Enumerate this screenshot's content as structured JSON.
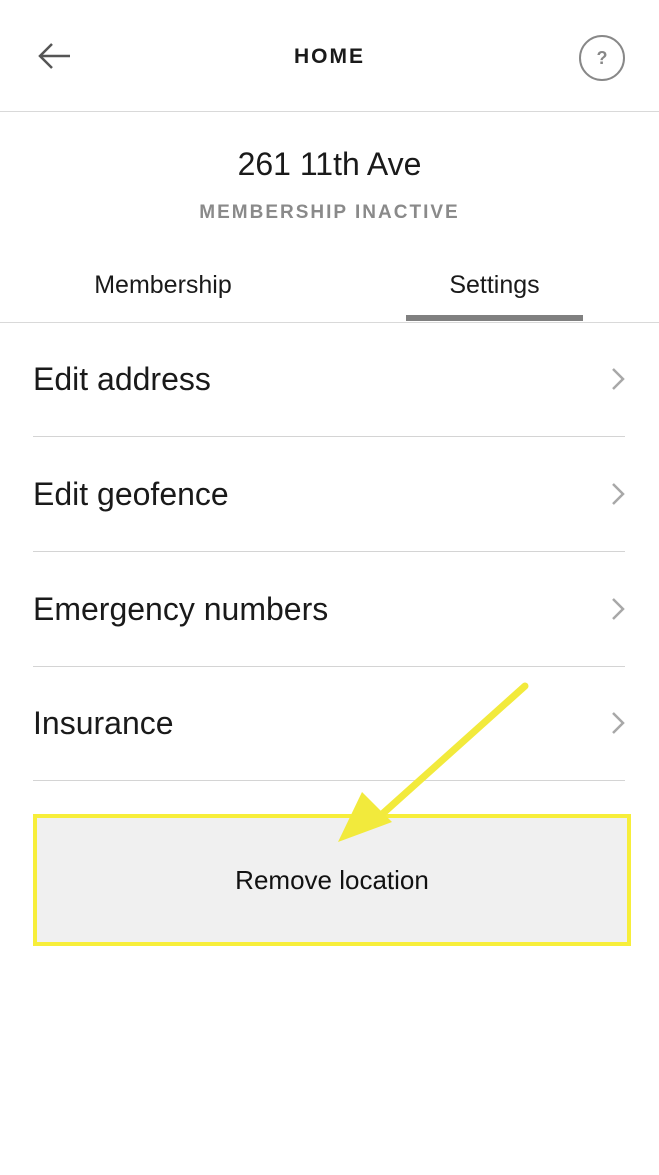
{
  "header": {
    "title": "HOME",
    "back_icon": "arrow-left-icon",
    "help_label": "?"
  },
  "location": {
    "address": "261 11th Ave",
    "status": "MEMBERSHIP INACTIVE"
  },
  "tabs": [
    {
      "label": "Membership",
      "active": false
    },
    {
      "label": "Settings",
      "active": true
    }
  ],
  "settings": {
    "items": [
      {
        "label": "Edit address"
      },
      {
        "label": "Edit geofence"
      },
      {
        "label": "Emergency numbers"
      },
      {
        "label": "Insurance"
      }
    ],
    "remove_label": "Remove location"
  },
  "colors": {
    "highlight": "#f7ee3a",
    "tab_indicator": "#808080",
    "muted": "#8a8a8a"
  }
}
